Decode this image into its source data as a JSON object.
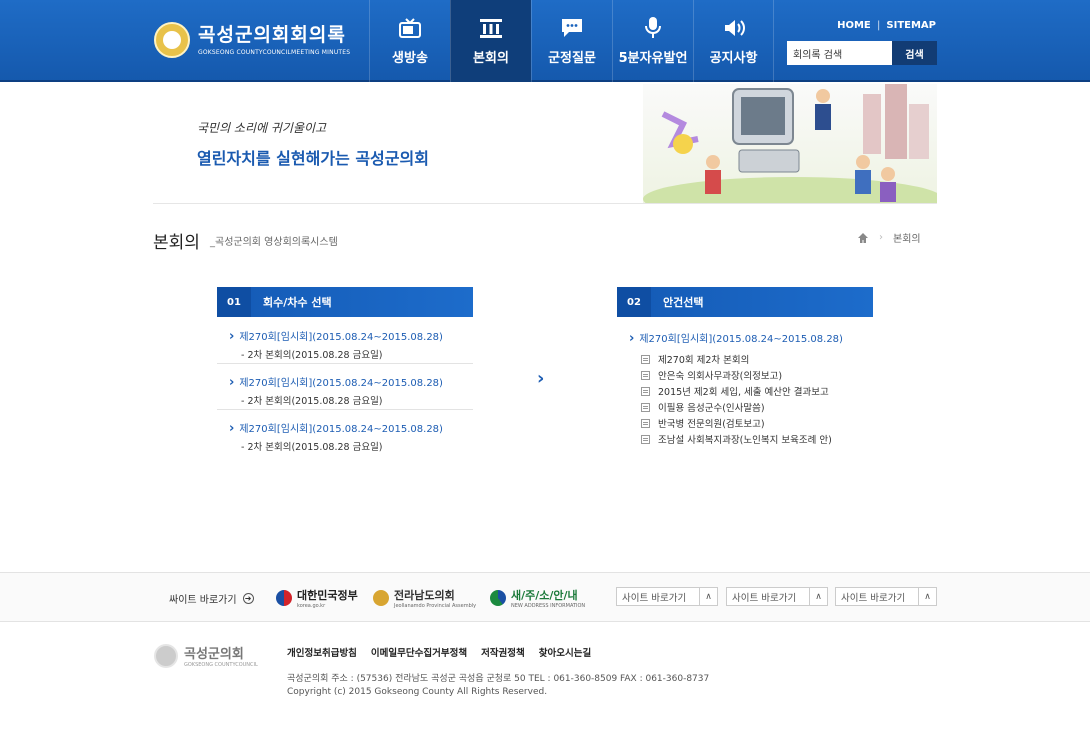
{
  "header": {
    "logo_title": "곡성군의회회의록",
    "logo_subtitle": "GOKSEONG COUNTYCOUNCILMEETING MINUTES",
    "nav": [
      {
        "label": "생방송",
        "icon": "tv-icon"
      },
      {
        "label": "본회의",
        "icon": "building-icon"
      },
      {
        "label": "군정질문",
        "icon": "speech-bubble-icon"
      },
      {
        "label": "5분자유발언",
        "icon": "microphone-icon"
      },
      {
        "label": "공지사항",
        "icon": "speaker-icon"
      }
    ],
    "util_home": "HOME",
    "util_sitemap": "SITEMAP",
    "search_value": "회의록 검색",
    "search_button": "검색"
  },
  "visual": {
    "slogan_small": "국민의 소리에 귀기울이고",
    "slogan_big": "열린자치를 실현해가는 곡성군의회"
  },
  "page": {
    "title": "본회의",
    "subtitle": "_곡성군의회 영상회의록시스템",
    "breadcrumb": "본회의"
  },
  "panel1": {
    "num": "01",
    "title": "회수/차수 선택",
    "sessions": [
      {
        "title": "제270회[임시회](2015.08.24~2015.08.28)",
        "sub": "- 2차 본회의(2015.08.28 금요일)"
      },
      {
        "title": "제270회[임시회](2015.08.24~2015.08.28)",
        "sub": "- 2차 본회의(2015.08.28 금요일)"
      },
      {
        "title": "제270회[임시회](2015.08.24~2015.08.28)",
        "sub": "- 2차 본회의(2015.08.28 금요일)"
      }
    ]
  },
  "panel2": {
    "num": "02",
    "title": "안건선택",
    "selected": "제270회[임시회](2015.08.24~2015.08.28)",
    "items": [
      "제270회 제2차 본회의",
      "안은숙 의회사무과장(의정보고)",
      "2015년 제2회 세입, 세출 예산안 결과보고",
      "이필용 음성군수(인사말씀)",
      "반국병 전문의원(검토보고)",
      "조남설 사회복지과장(노인복지 보육조례 안)"
    ]
  },
  "family": {
    "label": "싸이트 바로가기",
    "banners": [
      "대한민국정부",
      "전라남도의회",
      "새/주/소/안/내"
    ],
    "banner_subs": [
      "korea.go.kr",
      "Jeollanamdo Provincial Assembly",
      "NEW ADDRESS INFORMATION"
    ],
    "selects": [
      "사이트 바로가기",
      "사이트 바로가기",
      "사이트 바로가기"
    ]
  },
  "footer": {
    "logo_name": "곡성군의회",
    "logo_eng": "GOKSEONG COUNTYCOUNCIL",
    "links": [
      "개인정보취급방침",
      "이메일무단수집거부정책",
      "저작권정책",
      "찾아오시는길"
    ],
    "address": "곡성군의회   주소 : (57536) 전라남도 곡성군 곡성읍 군청로 50   TEL : 061-360-8509   FAX : 061-360-8737",
    "copyright": "Copyright (c) 2015 Gokseong County All Rights Reserved."
  },
  "colors": {
    "header_blue": "#1a63bd",
    "active_nav": "#0f3e7a",
    "link_blue": "#1d5db3"
  }
}
